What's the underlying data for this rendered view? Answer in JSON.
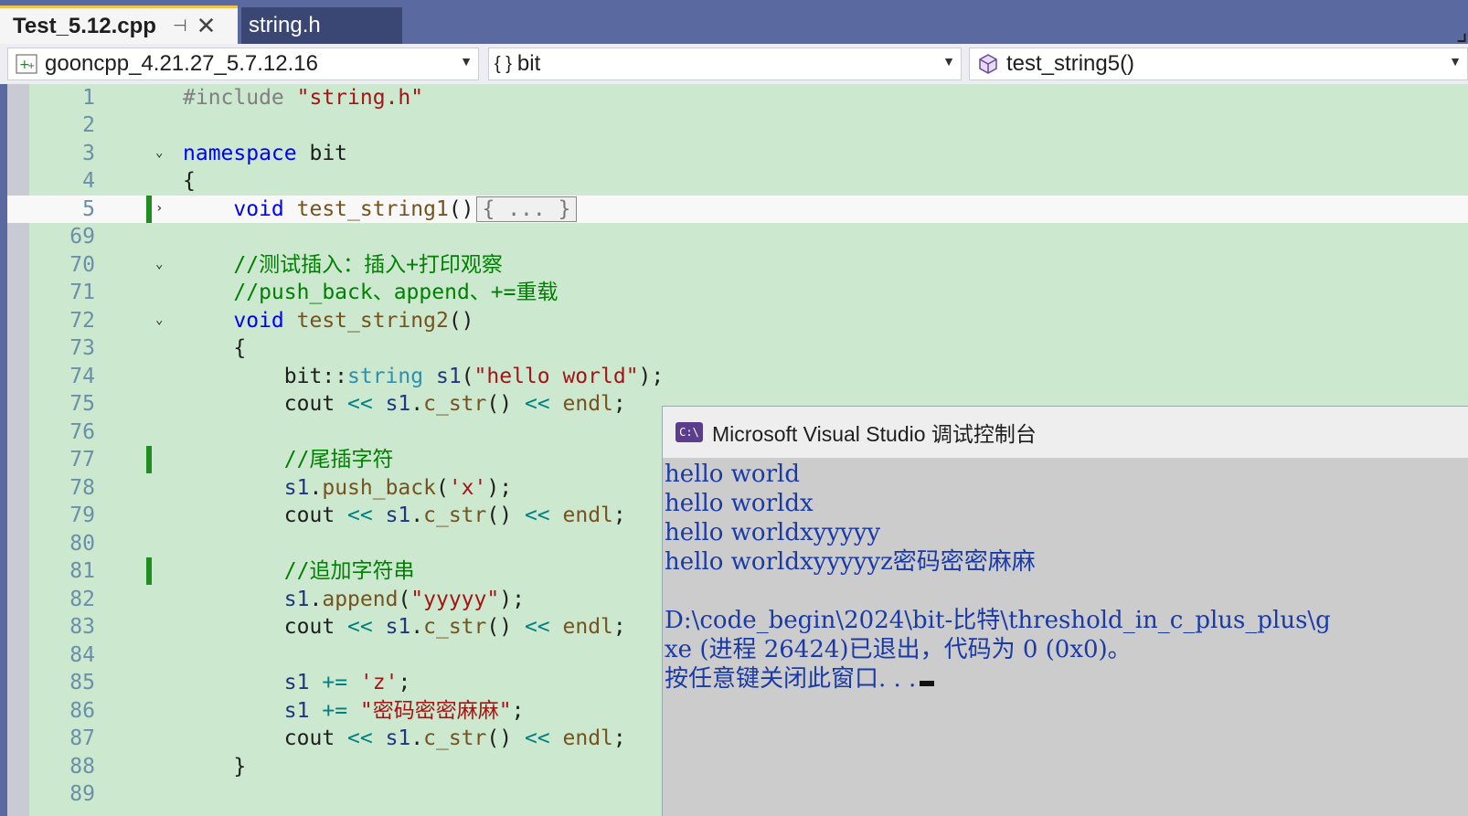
{
  "tabs": [
    {
      "label": "Test_5.12.cpp",
      "active": true
    },
    {
      "label": "string.h",
      "active": false
    }
  ],
  "nav": {
    "project": "gooncpp_4.21.27_5.7.12.16",
    "scope": "bit",
    "member": "test_string5()"
  },
  "editor": {
    "line_numbers": [
      "1",
      "2",
      "3",
      "4",
      "5",
      "69",
      "70",
      "71",
      "72",
      "73",
      "74",
      "75",
      "76",
      "77",
      "78",
      "79",
      "80",
      "81",
      "82",
      "83",
      "84",
      "85",
      "86",
      "87",
      "88",
      "89"
    ],
    "collapsed_marker": "{ ... }"
  },
  "console": {
    "title": "Microsoft Visual Studio 调试控制台",
    "lines": [
      "hello world",
      "hello worldx",
      "hello worldxyyyyy",
      "hello worldxyyyyyz密码密密麻麻",
      "",
      "D:\\code_begin\\2024\\bit-比特\\threshold_in_c_plus_plus\\g",
      "xe (进程 26424)已退出，代码为 0 (0x0)。",
      "按任意键关闭此窗口. . ."
    ]
  },
  "colors": {
    "editor_bg": "#cce8cf",
    "title_bar": "#5a6aa0",
    "keyword": "#0000ff",
    "string": "#a31515",
    "comment": "#008000",
    "console_text": "#1a3aa8"
  }
}
